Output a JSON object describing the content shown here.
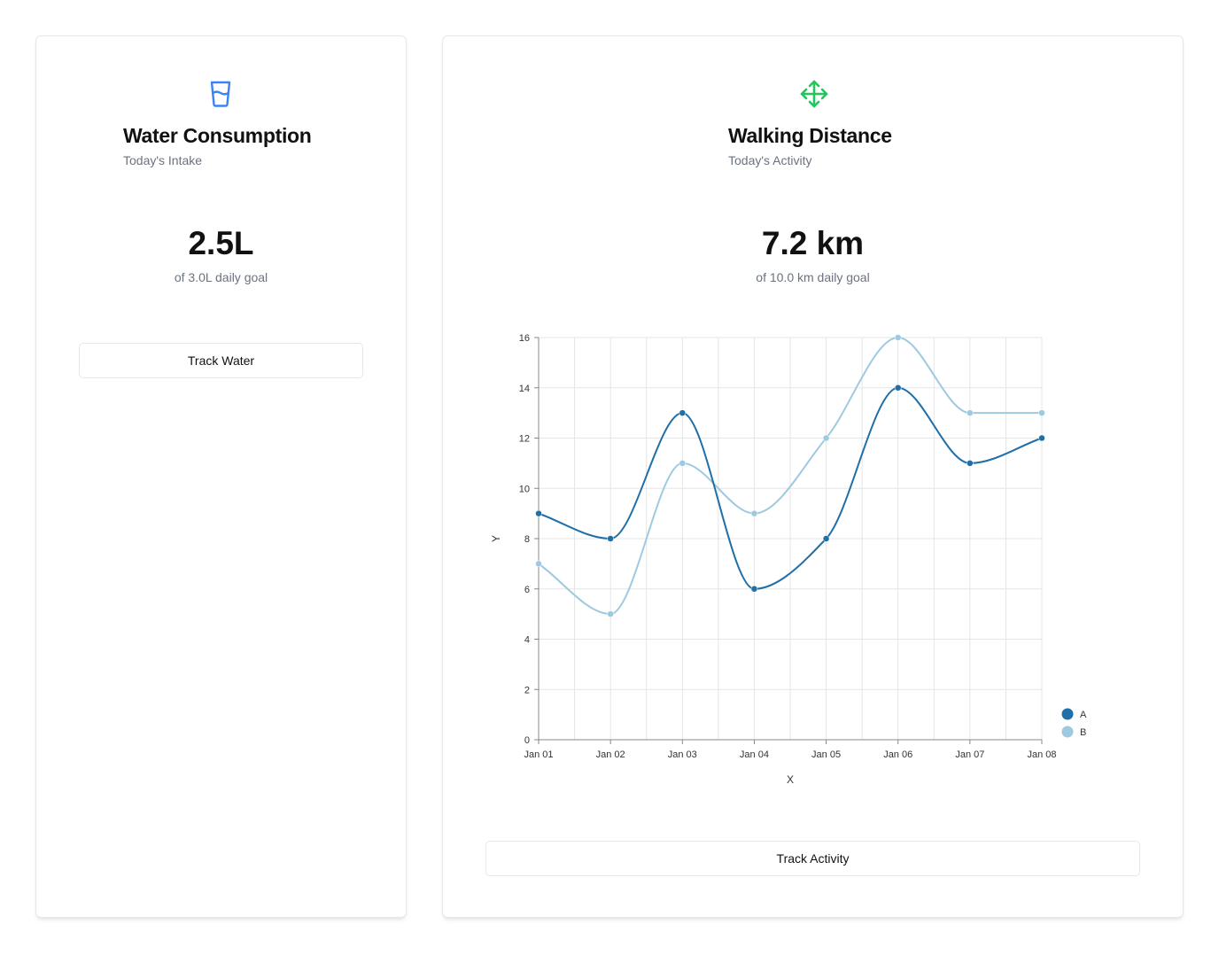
{
  "water": {
    "icon": "glass-water-icon",
    "title": "Water Consumption",
    "subtitle": "Today's Intake",
    "value": "2.5L",
    "goal": "of 3.0L daily goal",
    "button_label": "Track Water",
    "accent": "#3b82f6"
  },
  "walk": {
    "icon": "move-arrows-icon",
    "title": "Walking Distance",
    "subtitle": "Today's Activity",
    "value": "7.2 km",
    "goal": "of 10.0 km daily goal",
    "button_label": "Track Activity",
    "accent": "#22c55e"
  },
  "chart_data": {
    "type": "line",
    "curve": "smooth",
    "x": [
      "Jan 01",
      "Jan 02",
      "Jan 03",
      "Jan 04",
      "Jan 05",
      "Jan 06",
      "Jan 07",
      "Jan 08"
    ],
    "series": [
      {
        "name": "A",
        "values": [
          9,
          8,
          13,
          6,
          8,
          14,
          11,
          12
        ],
        "color": "#1f6fa8"
      },
      {
        "name": "B",
        "values": [
          7,
          5,
          11,
          9,
          12,
          16,
          13,
          13
        ],
        "color": "#9ecae1"
      }
    ],
    "xlabel": "X",
    "ylabel": "Y",
    "ylim": [
      0,
      16
    ],
    "yticks": [
      0,
      2,
      4,
      6,
      8,
      10,
      12,
      14,
      16
    ],
    "grid": true,
    "legend": "bottom-right"
  }
}
